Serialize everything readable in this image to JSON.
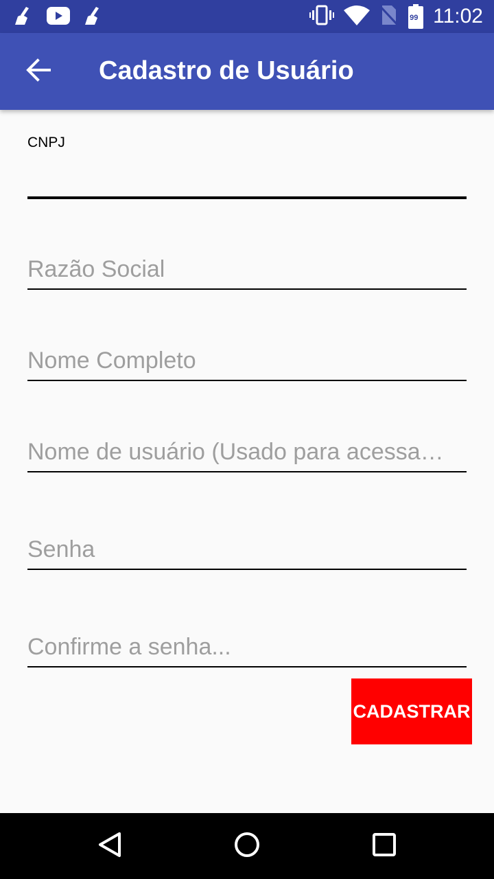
{
  "status_bar": {
    "time": "11:02",
    "battery_level": "99",
    "left_icons": [
      "broom-icon",
      "youtube-icon",
      "broom-icon"
    ],
    "right_icons": [
      "vibrate-icon",
      "wifi-icon",
      "no-sim-icon",
      "battery-icon"
    ]
  },
  "app_bar": {
    "title": "Cadastro de Usuário",
    "back_icon": "arrow-back-icon",
    "color": "#3f51b5",
    "status_color": "#303f9f"
  },
  "form": {
    "cnpj": {
      "label": "CNPJ",
      "value": ""
    },
    "razao_social": {
      "placeholder": "Razão Social",
      "value": ""
    },
    "nome_completo": {
      "placeholder": "Nome Completo",
      "value": ""
    },
    "nome_usuario": {
      "placeholder": "Nome de usuário (Usado para acessa…",
      "value": ""
    },
    "senha": {
      "placeholder": "Senha",
      "value": ""
    },
    "confirme_senha": {
      "placeholder": "Confirme a senha...",
      "value": ""
    }
  },
  "submit_button": {
    "label": "CADASTRAR",
    "color": "#ff0000"
  },
  "nav_bar": {
    "icons": [
      "back-triangle-icon",
      "home-circle-icon",
      "recents-square-icon"
    ]
  }
}
